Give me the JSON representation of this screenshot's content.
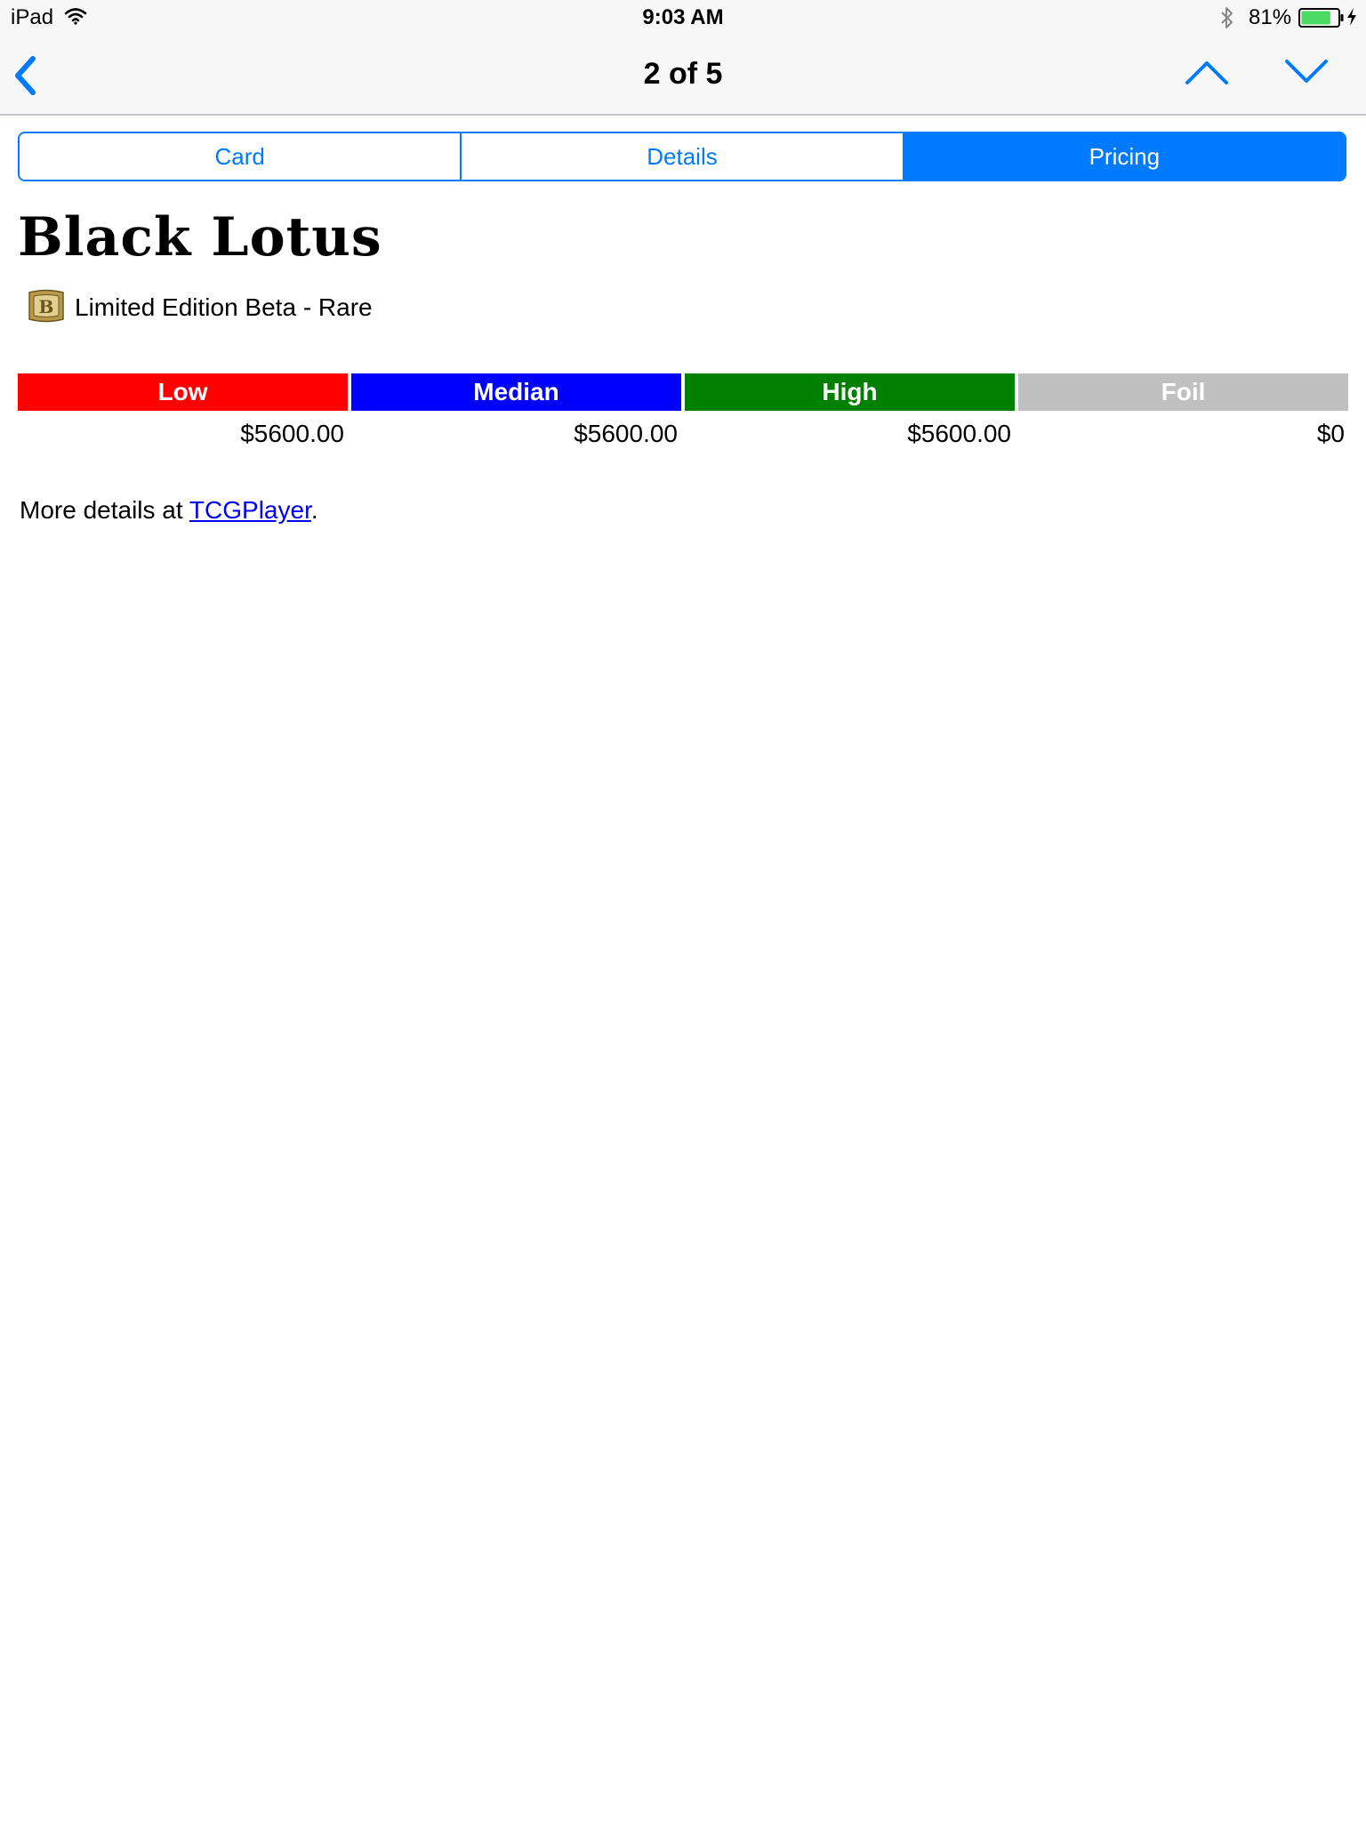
{
  "status_bar": {
    "device": "iPad",
    "time": "9:03 AM",
    "battery_percent": "81%",
    "wifi_icon": "wifi-icon",
    "bluetooth_icon": "bluetooth-icon",
    "battery_icon": "battery-icon",
    "battery_level": 0.81,
    "battery_color": "#4cd964",
    "charging_icon": "charging-bolt-icon"
  },
  "nav_bar": {
    "title": "2 of 5",
    "back_icon": "chevron-left-icon",
    "prev_icon": "chevron-up-icon",
    "next_icon": "chevron-down-icon",
    "tint_color": "#007aff"
  },
  "tabs": [
    {
      "label": "Card",
      "selected": false
    },
    {
      "label": "Details",
      "selected": false
    },
    {
      "label": "Pricing",
      "selected": true
    }
  ],
  "card": {
    "name": "Black Lotus",
    "set_icon": "set-symbol-icon",
    "set_icon_letter": "B",
    "set_line": "Limited Edition Beta - Rare"
  },
  "pricing": {
    "columns": [
      {
        "label": "Low",
        "value": "$5600.00",
        "color": "#ff0000"
      },
      {
        "label": "Median",
        "value": "$5600.00",
        "color": "#0000ff"
      },
      {
        "label": "High",
        "value": "$5600.00",
        "color": "#008000"
      },
      {
        "label": "Foil",
        "value": "$0",
        "color": "#c0c0c0"
      }
    ]
  },
  "footer": {
    "prefix": "More details at ",
    "link_text": "TCGPlayer",
    "suffix": "."
  }
}
